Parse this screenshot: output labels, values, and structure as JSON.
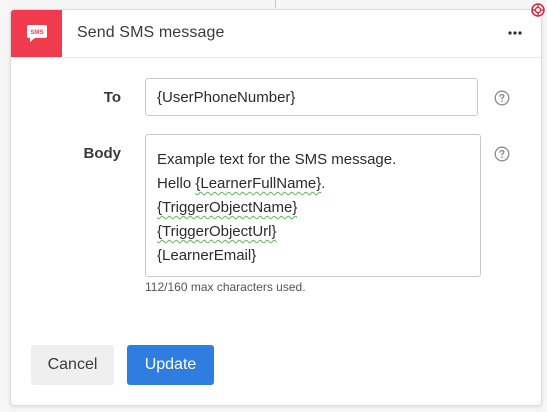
{
  "dialog": {
    "title": "Send SMS message",
    "icon_text": "SMS",
    "icon_color": "#ef3b4d",
    "more_icon": "more-horizontal-icon"
  },
  "fields": {
    "to": {
      "label": "To",
      "value": "{UserPhoneNumber}",
      "help_icon": "question-circle-icon"
    },
    "body": {
      "label": "Body",
      "help_icon": "question-circle-icon",
      "lines": [
        "Example text for the SMS message.",
        "Hello {LearnerFullName}.",
        "{TriggerObjectName}",
        "{TriggerObjectUrl}",
        "{LearnerEmail}"
      ],
      "char_count": "112/160 max characters used."
    }
  },
  "actions": {
    "cancel_label": "Cancel",
    "update_label": "Update",
    "accent": "#2f7de1"
  },
  "corner_badge_icon": "target-icon"
}
